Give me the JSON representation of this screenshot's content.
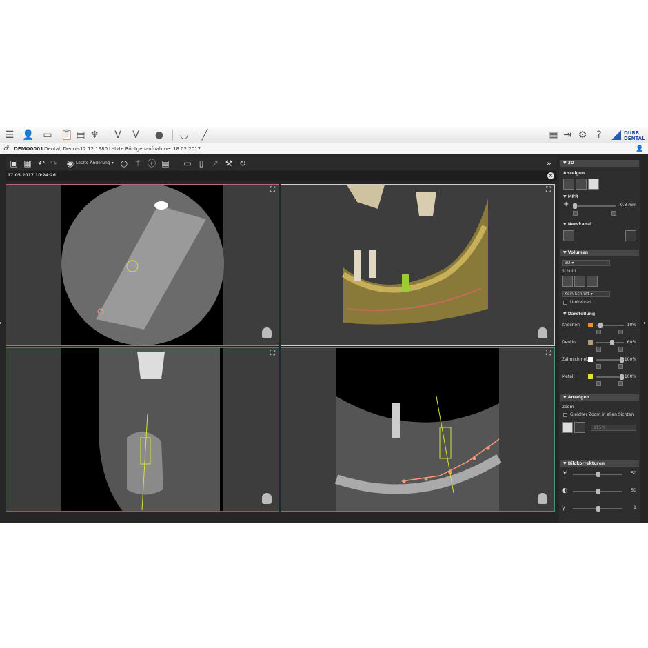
{
  "patient": {
    "id": "DEMO0001",
    "name": "Dental, Dennis",
    "dob": "12.12.1980",
    "last_xray": "Letzte Röntgenaufnahme: 18.02.2017"
  },
  "toolbar": {
    "last_change": "Letzte Änderung ▾"
  },
  "session": {
    "date": "17.05.2017 10:24:26"
  },
  "brand": {
    "line1": "DÜRR",
    "line2": "DENTAL"
  },
  "panel": {
    "s3d": "▼ 3D",
    "anzeigen": "Anzeigen",
    "mpr": "▼ MPR",
    "mpr_value": "0.3 mm",
    "nerv": "▼ Nervkanal",
    "volumen": "▼ Volumen",
    "volumen_sel": "3D ▾",
    "schnitt": "Schnitt",
    "schnitt_sel": "Kein Schnitt ▾",
    "umkehren": "Umkehren",
    "darstellung": "▼ Darstellung",
    "tissues": [
      {
        "name": "Knochen",
        "value": "10%",
        "color": "#e8922a"
      },
      {
        "name": "Dentin",
        "value": "60%",
        "color": "#b89c6c"
      },
      {
        "name": "Zahnschmelz",
        "value": "100%",
        "color": "#ffffff"
      },
      {
        "name": "Metall",
        "value": "100%",
        "color": "#e8e030"
      }
    ],
    "anzeigen2": "▼ Anzeigen",
    "zoom": "Zoom",
    "zoom_all": "Gleicher Zoom in allen Sichten",
    "zoom_val": "115%",
    "bild": "▼ Bildkorrekturen",
    "b1": "50",
    "b2": "50",
    "b3": "1"
  },
  "colors": {
    "axial": "#b86a78",
    "tr3d": "#cfcfcf",
    "bl": "#4a6ccc",
    "br": "#3f9a6a",
    "implant": "#d8e03a",
    "nerve": "#ff9a7a"
  }
}
